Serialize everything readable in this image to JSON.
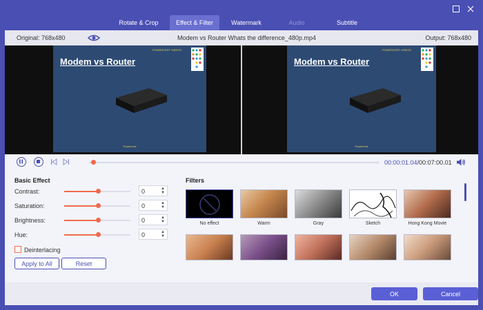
{
  "tabs": [
    {
      "label": "Rotate & Crop",
      "state": "normal"
    },
    {
      "label": "Effect & Filter",
      "state": "active"
    },
    {
      "label": "Watermark",
      "state": "normal"
    },
    {
      "label": "Audio",
      "state": "disabled"
    },
    {
      "label": "Subtitle",
      "state": "normal"
    }
  ],
  "window_buttons": {
    "maximize": "maximize-icon",
    "close": "close-icon"
  },
  "infobar": {
    "original": "Original: 768x480",
    "filename": "Modem vs Router  Whats the difference_480p.mp4",
    "output": "Output: 768x480"
  },
  "preview": {
    "title": "Modem vs Router",
    "brand_top": "POWERCERT VIDEOS",
    "brand_bottom": "PowerCert"
  },
  "playback": {
    "current": "00:00:01.04",
    "total": "/00:07:00.01",
    "progress": 0.01
  },
  "basic_effect": {
    "title": "Basic Effect",
    "rows": [
      {
        "label": "Contrast:",
        "value": "0",
        "level": 0.5
      },
      {
        "label": "Saturation:",
        "value": "0",
        "level": 0.5
      },
      {
        "label": "Brightness:",
        "value": "0",
        "level": 0.5
      },
      {
        "label": "Hue:",
        "value": "0",
        "level": 0.5
      }
    ],
    "deinterlacing": "Deinterlacing",
    "apply_all": "Apply to All",
    "reset": "Reset"
  },
  "filters": {
    "title": "Filters",
    "items": [
      {
        "label": "No effect",
        "style": "none"
      },
      {
        "label": "Warm",
        "style": "warm"
      },
      {
        "label": "Gray",
        "style": "gray"
      },
      {
        "label": "Sketch",
        "style": "sketch"
      },
      {
        "label": "Hong Kong Movie",
        "style": "hk"
      }
    ],
    "second_row": [
      {
        "style": "orange"
      },
      {
        "style": "purple"
      },
      {
        "style": "rose"
      },
      {
        "style": "fade"
      },
      {
        "style": "pale"
      }
    ]
  },
  "footer": {
    "ok": "OK",
    "cancel": "Cancel"
  },
  "colors": {
    "accent": "#4a4fb3",
    "slider": "#f06a4a",
    "primary_button": "#5a5fd6"
  }
}
